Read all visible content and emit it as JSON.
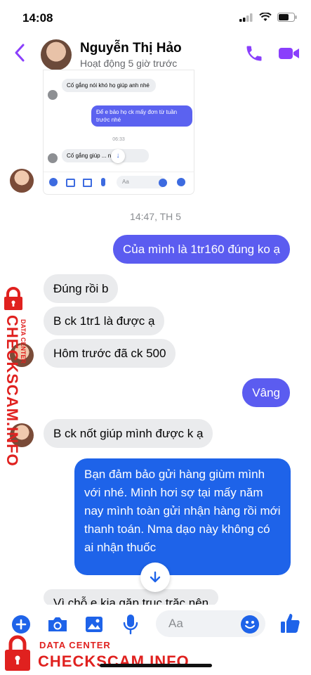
{
  "status_bar": {
    "time": "14:08"
  },
  "header": {
    "name": "Nguyễn Thị Hảo",
    "status": "Hoạt động 5 giờ trước"
  },
  "embedded": {
    "msg1": "Cố gắng nói khó họ giúp anh nhé",
    "msg2": "Để e bảo họ ck mấy đơn từ tuần trước nhé",
    "time": "06:33",
    "msg3": "Cố gắng giúp ... nhé",
    "input_placeholder": "Aa"
  },
  "timestamp": "14:47, TH 5",
  "messages": {
    "out1": "Của mình là 1tr160 đúng ko ạ",
    "in1": "Đúng rồi b",
    "in2": "B ck 1tr1 là được ạ",
    "in3": "Hôm trước đã ck 500",
    "out2": "Vâng",
    "in4": "B ck nốt giúp mình được k ạ",
    "out3": "Bạn đảm bảo gửi hàng giùm mình với nhé. Mình hơi sợ tại mấy năm nay mình toàn gửi nhận hàng rồi mới thanh toán. Nma dạo này không có ai nhận thuốc",
    "in5_partial": "Vì chỗ e kia gặp trục trặc nên"
  },
  "composer": {
    "placeholder": "Aa"
  },
  "watermark": {
    "line1": "DATA CENTER",
    "line2": "CHECKSCAM.INFO"
  },
  "colors": {
    "accent": "#8a3ffc",
    "outgoing": "#5b5cf0",
    "outgoing_dark": "#1e63e9",
    "incoming": "#eaebed",
    "watermark": "#e0211f"
  }
}
